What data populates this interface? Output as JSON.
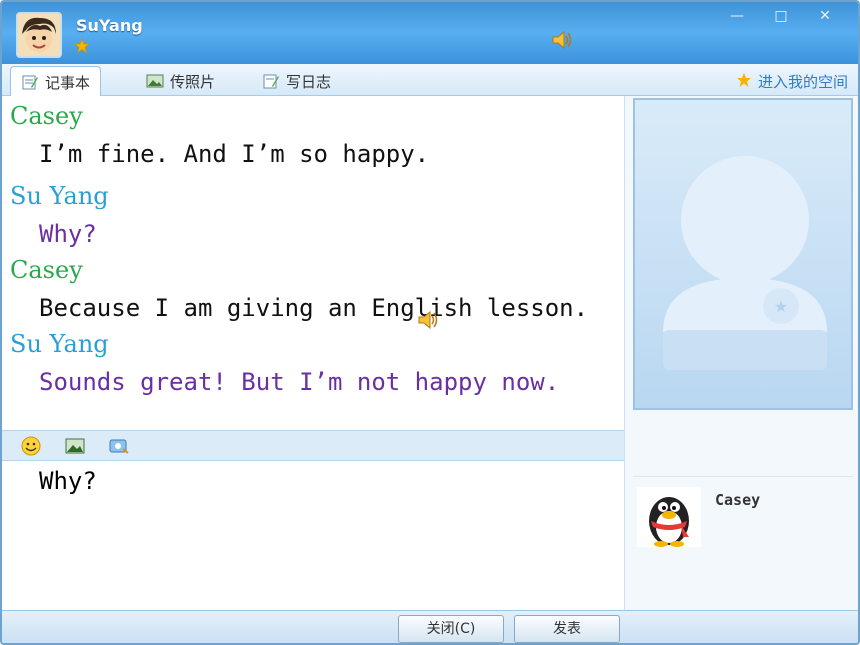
{
  "window": {
    "username": "SuYang",
    "controls": [
      "—",
      "□",
      "✕"
    ]
  },
  "tabs": [
    {
      "label": "记事本",
      "icon": "notepad-icon",
      "active": true
    },
    {
      "label": "传照片",
      "icon": "photo-icon",
      "active": false
    },
    {
      "label": "写日志",
      "icon": "diary-icon",
      "active": false
    }
  ],
  "space_link": {
    "label": "进入我的空间",
    "icon": "star-icon"
  },
  "messages": [
    {
      "name": "Casey",
      "text": "I’m fine. And I’m so happy.",
      "name_color": "#2aa84a",
      "text_color": "#111111"
    },
    {
      "name": "Su Yang",
      "text": "Why?",
      "name_color": "#2a9fd6",
      "text_color": "#6a2fa0"
    },
    {
      "name": "Casey",
      "text": "Because I am giving an English lesson.",
      "name_color": "#2aa84a",
      "text_color": "#111111"
    },
    {
      "name": "Su Yang",
      "text": "Sounds great! But I’m not happy now.",
      "name_color": "#2a9fd6",
      "text_color": "#6a2fa0"
    }
  ],
  "input": {
    "value": "Why?"
  },
  "buttons": {
    "close": "关闭(C)",
    "send": "发表"
  },
  "contact": {
    "name": "Casey"
  },
  "colors": {
    "accent": "#3f93d8",
    "panel": "#d9ebf9"
  }
}
